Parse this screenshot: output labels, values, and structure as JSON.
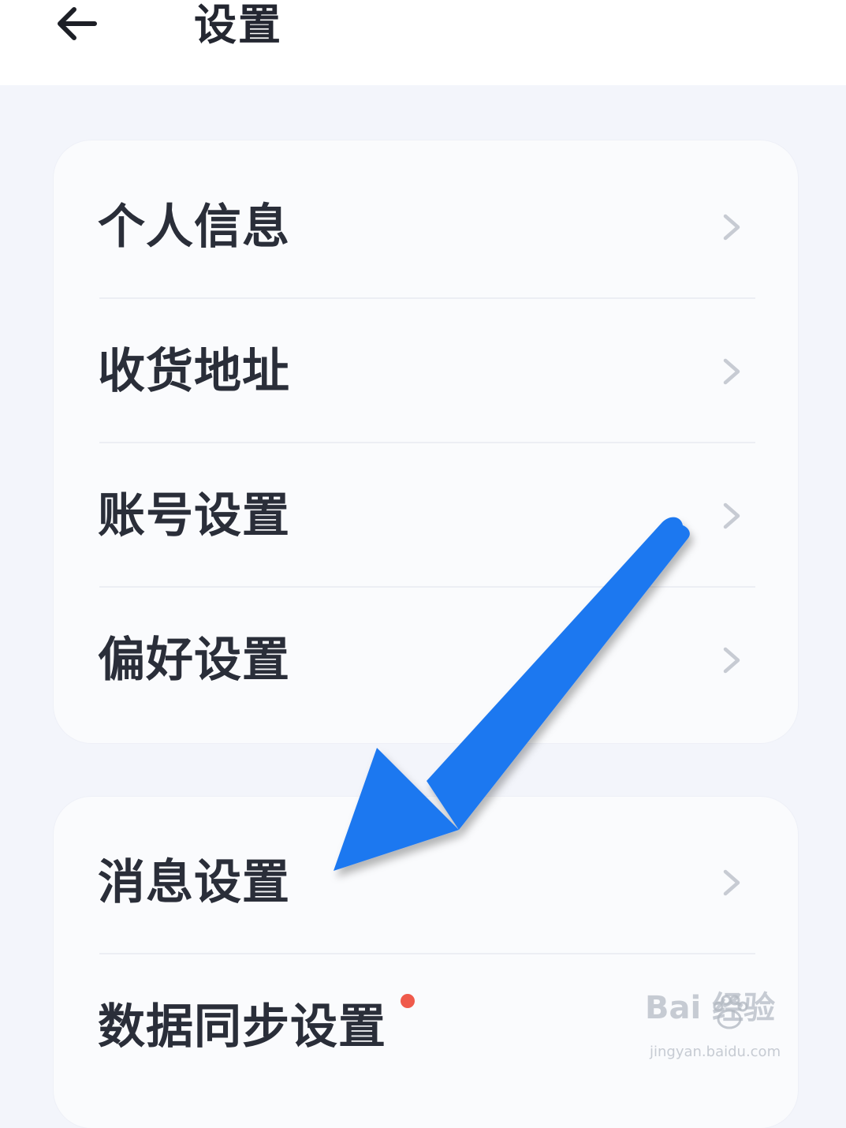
{
  "header": {
    "title": "设置",
    "back_icon": "arrow-left-icon"
  },
  "groups": [
    {
      "items": [
        {
          "label": "个人信息",
          "icon": "chevron-right-icon"
        },
        {
          "label": "收货地址",
          "icon": "chevron-right-icon"
        },
        {
          "label": "账号设置",
          "icon": "chevron-right-icon"
        },
        {
          "label": "偏好设置",
          "icon": "chevron-right-icon"
        }
      ]
    },
    {
      "items": [
        {
          "label": "消息设置",
          "icon": "chevron-right-icon"
        },
        {
          "label": "数据同步设置",
          "badge": "red-dot"
        }
      ]
    }
  ],
  "watermark": {
    "main": "Bai 经验",
    "url": "jingyan.baidu.com"
  },
  "colors": {
    "background": "#f3f5fb",
    "card": "#fafbfd",
    "text": "#2a2e39",
    "chevron": "#c7cbd3",
    "badge": "#ef5a4b",
    "annotation_arrow": "#1f78f0"
  }
}
